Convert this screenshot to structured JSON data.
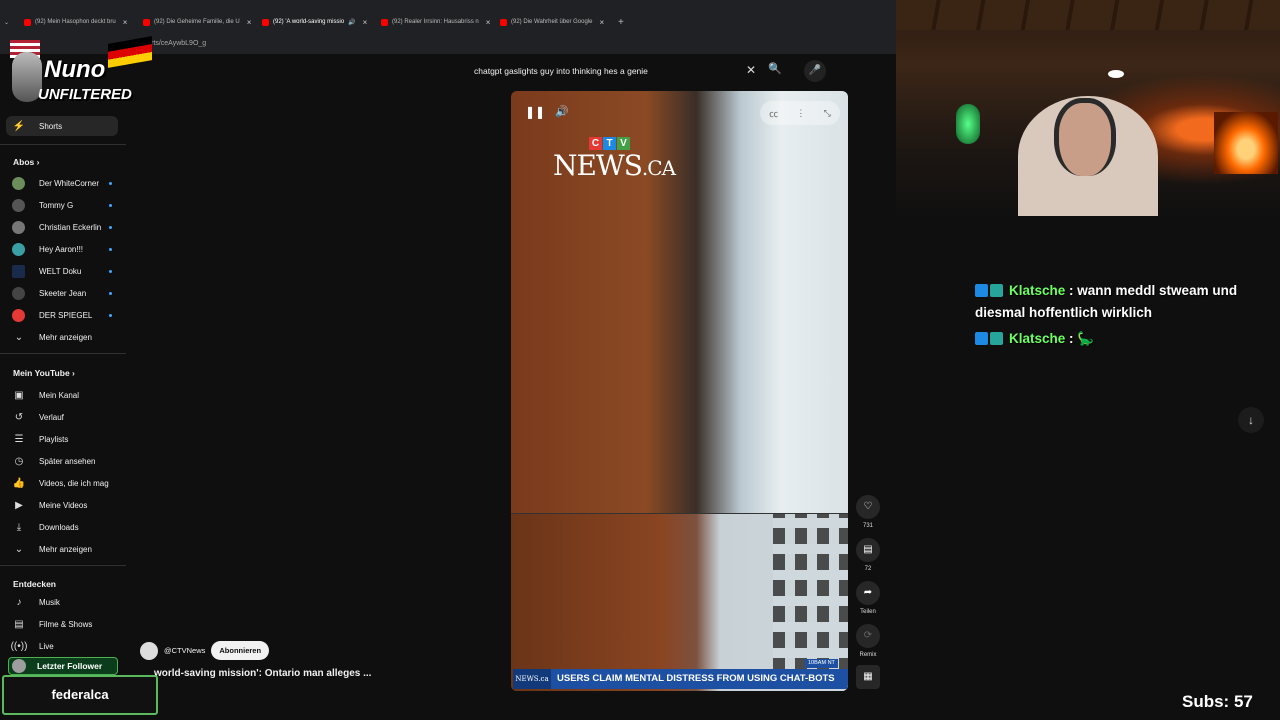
{
  "browser": {
    "tabs": [
      {
        "label": "(92) Mein Hasophon deckt bru"
      },
      {
        "label": "(92) Die Geheime Familie, die U"
      },
      {
        "label": "(92) 'A world-saving missio"
      },
      {
        "label": "(92) Realer Irrsinn: Hausabriss n"
      },
      {
        "label": "(92) Die Wahrheit über Google"
      }
    ],
    "new_tab": "+",
    "url": "m/shorts/ceAywbL9O_g"
  },
  "sidebar": {
    "shorts": "Shorts",
    "abos_header": "Abos",
    "subscriptions": [
      {
        "label": "Der WhiteCorner",
        "color": "#6b8e5a"
      },
      {
        "label": "Tommy G",
        "color": "#555555"
      },
      {
        "label": "Christian Eckerlin",
        "color": "#777777"
      },
      {
        "label": "Hey Aaron!!!",
        "color": "#3a9ea5"
      },
      {
        "label": "WELT Doku",
        "color": "#1a2a4a"
      },
      {
        "label": "Skeeter Jean",
        "color": "#444444"
      },
      {
        "label": "DER SPIEGEL",
        "color": "#e53935"
      }
    ],
    "abos_more": "Mehr anzeigen",
    "my_youtube_header": "Mein YouTube",
    "my_youtube": [
      {
        "label": "Mein Kanal",
        "icon": "account-box-icon"
      },
      {
        "label": "Verlauf",
        "icon": "history-icon"
      },
      {
        "label": "Playlists",
        "icon": "playlist-icon"
      },
      {
        "label": "Später ansehen",
        "icon": "clock-icon"
      },
      {
        "label": "Videos, die ich mag",
        "icon": "thumbs-up-icon"
      },
      {
        "label": "Meine Videos",
        "icon": "video-icon"
      },
      {
        "label": "Downloads",
        "icon": "download-icon"
      }
    ],
    "my_youtube_more": "Mehr anzeigen",
    "explore_header": "Entdecken",
    "explore": [
      {
        "label": "Musik",
        "icon": "music-icon"
      },
      {
        "label": "Filme & Shows",
        "icon": "film-icon"
      },
      {
        "label": "Live",
        "icon": "live-icon"
      }
    ]
  },
  "search": {
    "query": "chatgpt gaslights guy into thinking hes a genie"
  },
  "video": {
    "brand_letters": [
      "C",
      "T",
      "V"
    ],
    "brand_colors": [
      "#e53935",
      "#1e88e5",
      "#43a047"
    ],
    "brand_name": "NEWS",
    "brand_suffix": ".CA",
    "chyron_logo": "NEWS.ca",
    "chyron_text": "USERS CLAIM MENTAL DISTRESS FROM USING CHAT-BOTS",
    "live_tag": "10BAM NT"
  },
  "actions": {
    "likes": "731",
    "comments": "72",
    "share": "Teilen",
    "remix": "Remix"
  },
  "channel": {
    "handle": "@CTVNews",
    "subscribe": "Abonnieren",
    "title": "world-saving mission': Ontario man alleges ..."
  },
  "overlay": {
    "logo_line1": "Nuno",
    "logo_line2": "UNFILTERED",
    "follower_label": "Letzter Follower",
    "follower_name": "federalca",
    "chat": [
      {
        "user": "Klatsche",
        "text": ": wann meddl stweam und diesmal hoffentlich wirklich"
      },
      {
        "user": "Klatsche",
        "text": ": 🦕"
      }
    ],
    "subs": "Subs: 57"
  }
}
